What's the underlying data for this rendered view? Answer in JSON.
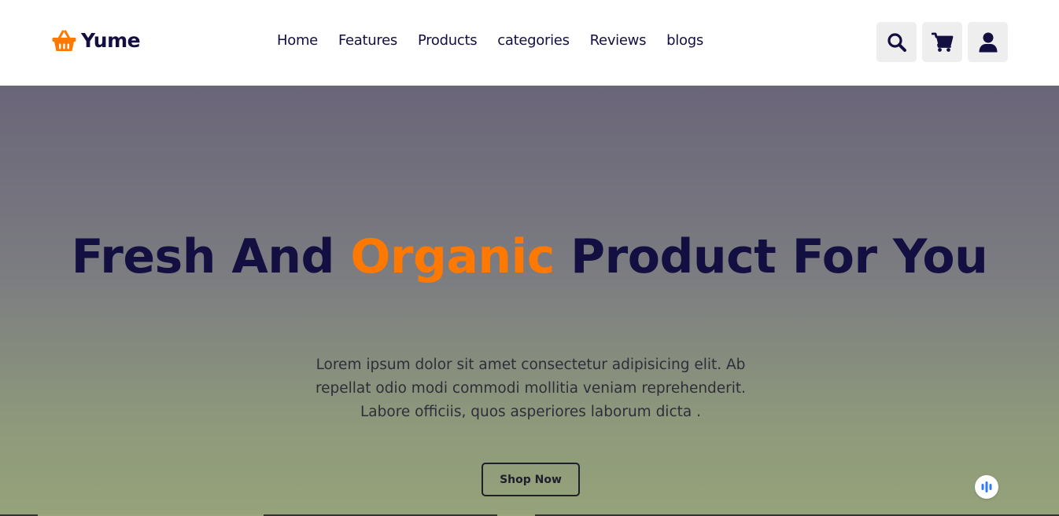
{
  "brand": {
    "name": "Yume",
    "accent_color": "#ff7800",
    "text_color": "#130f40",
    "logo_icon": "basket-icon"
  },
  "nav": {
    "items": [
      {
        "label": "Home"
      },
      {
        "label": "Features"
      },
      {
        "label": "Products"
      },
      {
        "label": "categories"
      },
      {
        "label": "Reviews"
      },
      {
        "label": "blogs"
      }
    ]
  },
  "header_icons": {
    "search": "search-icon",
    "cart": "cart-icon",
    "user": "user-icon"
  },
  "hero": {
    "title_part1": "Fresh And ",
    "title_accent": "Organic",
    "title_part2": " Product For You",
    "text": "Lorem ipsum dolor sit amet consectetur adipisicing elit. Ab repellat odio modi commodi mollitia veniam reprehenderit. Labore officiis, quos asperiores laborum dicta .",
    "button_label": "Shop Now"
  },
  "floating_widget": {
    "icon": "audio-bars-icon",
    "color": "#2f7cf6"
  }
}
